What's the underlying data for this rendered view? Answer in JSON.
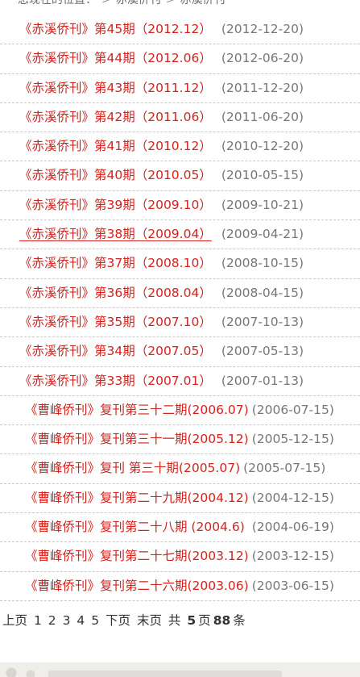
{
  "breadcrumb": [
    "您现在的位置：",
    "赤溪侨刊",
    "赤溪侨刊"
  ],
  "items": [
    {
      "title": "《赤溪侨刊》第45期（2012.12）",
      "date": "(2012-12-20)",
      "style": "s1"
    },
    {
      "title": "《赤溪侨刊》第44期（2012.06）",
      "date": "(2012-06-20)",
      "style": "s1"
    },
    {
      "title": "《赤溪侨刊》第43期（2011.12）",
      "date": "(2011-12-20)",
      "style": "s1"
    },
    {
      "title": "《赤溪侨刊》第42期（2011.06）",
      "date": "(2011-06-20)",
      "style": "s1"
    },
    {
      "title": "《赤溪侨刊》第41期（2010.12）",
      "date": "(2010-12-20)",
      "style": "s1"
    },
    {
      "title": "《赤溪侨刊》第40期（2010.05）",
      "date": "(2010-05-15)",
      "style": "s1"
    },
    {
      "title": "《赤溪侨刊》第39期（2009.10）",
      "date": "(2009-10-21)",
      "style": "s1"
    },
    {
      "title": "《赤溪侨刊》第38期（2009.04）",
      "date": "(2009-04-21)",
      "style": "s1",
      "hovered": true
    },
    {
      "title": "《赤溪侨刊》第37期（2008.10）",
      "date": "(2008-10-15)",
      "style": "s1"
    },
    {
      "title": "《赤溪侨刊》第36期（2008.04）",
      "date": "(2008-04-15)",
      "style": "s1"
    },
    {
      "title": "《赤溪侨刊》第35期（2007.10）",
      "date": "(2007-10-13)",
      "style": "s1"
    },
    {
      "title": "《赤溪侨刊》第34期（2007.05）",
      "date": "(2007-05-13)",
      "style": "s1"
    },
    {
      "title": "《赤溪侨刊》第33期（2007.01）",
      "date": "(2007-01-13)",
      "style": "s1"
    },
    {
      "title": "《曹峰侨刊》复刊第三十二期(2006.07)",
      "date": "(2006-07-15)",
      "style": "s2"
    },
    {
      "title": "《曹峰侨刊》复刊第三十一期(2005.12)",
      "date": "(2005-12-15)",
      "style": "s2"
    },
    {
      "title": "《曹峰侨刊》复刊 第三十期(2005.07)",
      "date": "(2005-07-15)",
      "style": "s2"
    },
    {
      "title": "《曹峰侨刊》复刊第二十九期(2004.12)",
      "date": "(2004-12-15)",
      "style": "s2"
    },
    {
      "title": "《曹峰侨刊》复刊第二十八期 (2004.6)",
      "date": " (2004-06-19)",
      "style": "s2"
    },
    {
      "title": "《曹峰侨刊》复刊第二十七期(2003.12)",
      "date": "(2003-12-15)",
      "style": "s2"
    },
    {
      "title": "《曹峰侨刊》复刊第二十六期(2003.06)",
      "date": "(2003-06-15)",
      "style": "s2"
    }
  ],
  "pager": {
    "prev": "上页",
    "pages": [
      "1",
      "2",
      "3",
      "4",
      "5"
    ],
    "next": "下页",
    "last": "末页",
    "total_prefix": "共",
    "total_pages": "5",
    "pages_unit": "页",
    "total_items": "88",
    "items_unit": "条"
  }
}
